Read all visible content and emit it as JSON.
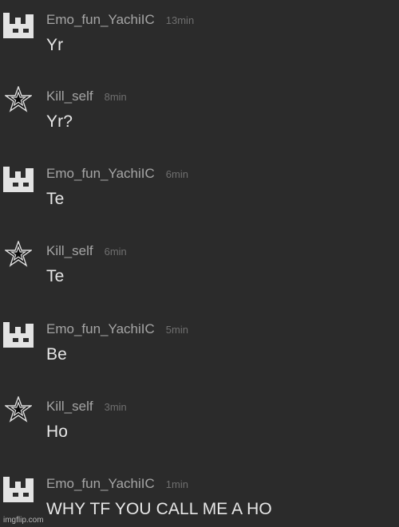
{
  "messages": [
    {
      "user": "Emo_fun_YachiIC",
      "time": "13min",
      "text": "Yr",
      "avatar": "emo-avatar"
    },
    {
      "user": "Kill_self",
      "time": "8min",
      "text": "Yr?",
      "avatar": "star-avatar"
    },
    {
      "user": "Emo_fun_YachiIC",
      "time": "6min",
      "text": "Te",
      "avatar": "emo-avatar"
    },
    {
      "user": "Kill_self",
      "time": "6min",
      "text": "Te",
      "avatar": "star-avatar"
    },
    {
      "user": "Emo_fun_YachiIC",
      "time": "5min",
      "text": "Be",
      "avatar": "emo-avatar"
    },
    {
      "user": "Kill_self",
      "time": "3min",
      "text": "Ho",
      "avatar": "star-avatar"
    },
    {
      "user": "Emo_fun_YachiIC",
      "time": "1min",
      "text": "WHY TF YOU CALL ME A HO",
      "avatar": "emo-avatar"
    }
  ],
  "watermark": "imgflip.com",
  "colors": {
    "background": "#2b2b2b",
    "username": "#a5a5a5",
    "timestamp": "#6f6f6f",
    "message_text": "#e6e6e6"
  }
}
